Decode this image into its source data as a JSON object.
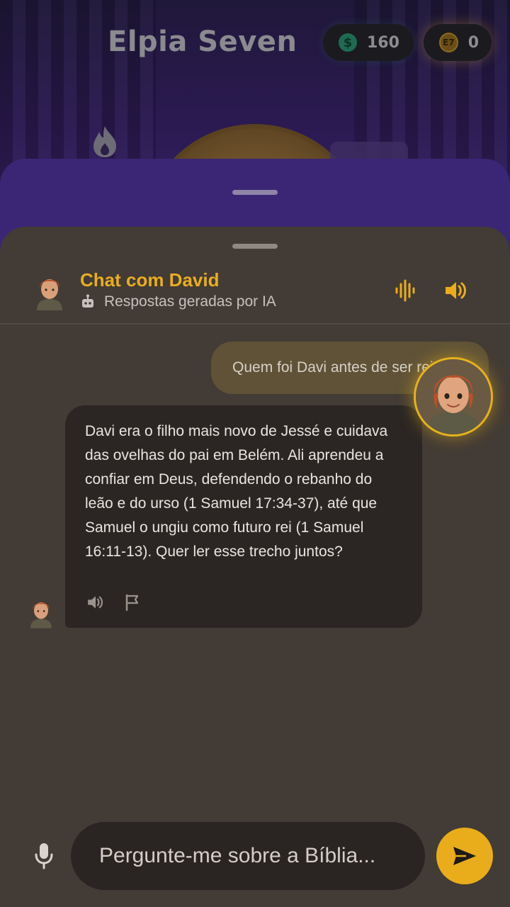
{
  "app": {
    "title": "Elpia Seven",
    "cash_amount": "160",
    "ticket_amount": "0",
    "ticket_symbol": "E7"
  },
  "chat": {
    "title": "Chat com David",
    "ai_notice": "Respostas geradas por IA",
    "messages": [
      {
        "from": "user",
        "text": "Quem foi Davi antes de ser rei?"
      },
      {
        "from": "bot",
        "text": "Davi era o filho mais novo de Jessé e cuidava das ovelhas do pai em Belém. Ali aprendeu a confiar em Deus, defendendo o rebanho do leão e do urso (1 Samuel 17:34-37), até que Samuel o ungiu como futuro rei (1 Samuel 16:11-13). Quer ler esse trecho juntos?"
      }
    ],
    "input_placeholder": "Pergunte-me sobre a Bíblia..."
  },
  "colors": {
    "accent": "#e9ad1c",
    "sheet": "#433b35",
    "bubble_bot": "#2b2624",
    "bubble_user": "#5f5237"
  },
  "icons": {
    "cash": "dollar-icon",
    "ticket": "e7-token-icon",
    "ai": "robot-icon",
    "voice": "voice-wave-icon",
    "speaker": "speaker-icon",
    "flag": "flag-icon",
    "mic": "microphone-icon",
    "send": "send-icon"
  }
}
